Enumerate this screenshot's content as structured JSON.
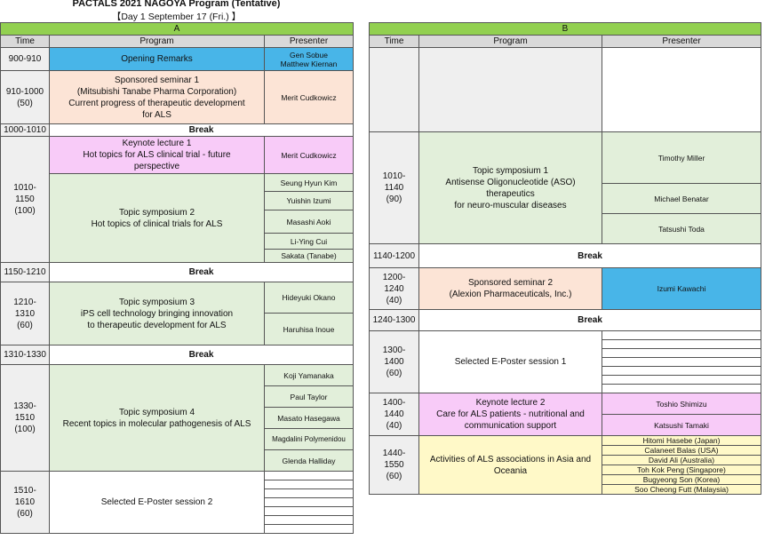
{
  "header": {
    "title": "PACTALS 2021 NAGOYA Program (Tentative)",
    "day": "【Day 1  September 17 (Fri.) 】"
  },
  "columns": {
    "time": "Time",
    "program": "Program",
    "presenter": "Presenter"
  },
  "venue_a": {
    "label": "A",
    "rows": [
      {
        "time": "900-910",
        "program": "Opening Remarks",
        "presenters": [
          "Gen Sobue",
          "Matthew Kiernan"
        ]
      },
      {
        "time": "910-1000\n(50)",
        "program": "Sponsored seminar 1\n(Mitsubishi Tanabe Pharma Corporation)\nCurrent progress of therapeutic  development\nfor ALS",
        "presenters": [
          "Merit Cudkowicz"
        ]
      },
      {
        "time": "1000-1010",
        "program": "Break"
      },
      {
        "time": "1010-\n1150\n(100)",
        "program": "Keynote lecture 1\nHot topics for ALS clinical trial - future\nperspective",
        "presenters": [
          "Merit Cudkowicz"
        ]
      },
      {
        "program": "Topic symposium 2\nHot topics of clinical trials for ALS",
        "presenters": [
          "Seung Hyun Kim",
          "Yuishin Izumi",
          "Masashi Aoki",
          "Li-Ying Cui",
          "Sakata (Tanabe)"
        ]
      },
      {
        "time": "1150-1210",
        "program": "Break"
      },
      {
        "time": "1210-\n1310\n(60)",
        "program": "Topic symposium 3\niPS cell technology bringing innovation\nto therapeutic development for ALS",
        "presenters": [
          "Hideyuki Okano",
          "Haruhisa Inoue"
        ]
      },
      {
        "time": "1310-1330",
        "program": "Break"
      },
      {
        "time": "1330-\n1510\n(100)",
        "program": "Topic symposium 4\nRecent topics in molecular pathogenesis of ALS",
        "presenters": [
          "Koji Yamanaka",
          "Paul Taylor",
          "Masato Hasegawa",
          "Magdalini Polymenidou",
          "Glenda Halliday"
        ]
      },
      {
        "time": "1510-\n1610\n(60)",
        "program": "Selected E-Poster session 2"
      }
    ]
  },
  "venue_b": {
    "label": "B",
    "rows": [
      {
        "time": "1010-\n1140\n(90)",
        "program": "Topic symposium 1\nAntisense Oligonucleotide (ASO) therapeutics\nfor neuro-muscular diseases",
        "presenters": [
          "Timothy Miller",
          "Michael Benatar",
          "Tatsushi Toda"
        ]
      },
      {
        "time": "1140-1200",
        "program": "Break"
      },
      {
        "time": "1200-\n1240\n(40)",
        "program": "Sponsored seminar 2\n(Alexion Pharmaceuticals, Inc.)",
        "presenters": [
          "Izumi Kawachi"
        ]
      },
      {
        "time": "1240-1300",
        "program": "Break"
      },
      {
        "time": "1300-\n1400\n(60)",
        "program": "Selected E-Poster session 1"
      },
      {
        "time": "1400-\n1440\n(40)",
        "program": "Keynote lecture 2\nCare for ALS patients - nutritional and\ncommunication support",
        "presenters": [
          "Toshio Shimizu",
          "Katsushi Tamaki"
        ]
      },
      {
        "time": "1440-\n1550\n(60)",
        "program": "Activities of ALS associations in Asia and\nOceania",
        "presenters": [
          "Hitomi Hasebe  (Japan)",
          "Calaneet Balas  (USA)",
          "David Ali   (Australia)",
          "Toh Kok Peng (Singapore)",
          "Bugyeong Son (Korea)",
          "Soo Cheong Futt (Malaysia)"
        ]
      }
    ]
  }
}
